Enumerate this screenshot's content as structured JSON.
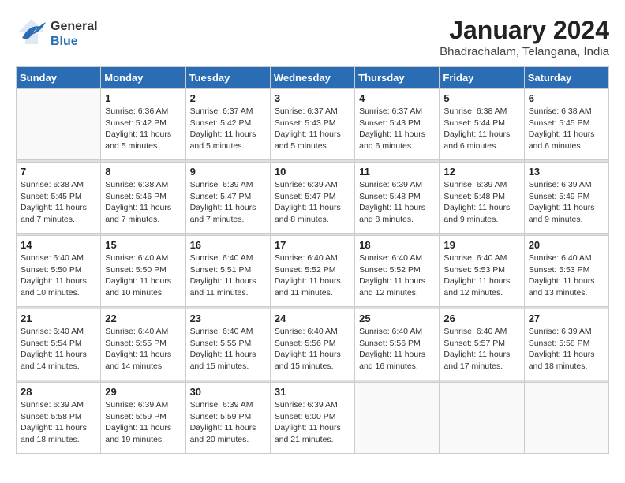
{
  "header": {
    "logo_line1": "General",
    "logo_line2": "Blue",
    "month_title": "January 2024",
    "subtitle": "Bhadrachalam, Telangana, India"
  },
  "weekdays": [
    "Sunday",
    "Monday",
    "Tuesday",
    "Wednesday",
    "Thursday",
    "Friday",
    "Saturday"
  ],
  "weeks": [
    [
      {
        "day": "",
        "info": ""
      },
      {
        "day": "1",
        "info": "Sunrise: 6:36 AM\nSunset: 5:42 PM\nDaylight: 11 hours\nand 5 minutes."
      },
      {
        "day": "2",
        "info": "Sunrise: 6:37 AM\nSunset: 5:42 PM\nDaylight: 11 hours\nand 5 minutes."
      },
      {
        "day": "3",
        "info": "Sunrise: 6:37 AM\nSunset: 5:43 PM\nDaylight: 11 hours\nand 5 minutes."
      },
      {
        "day": "4",
        "info": "Sunrise: 6:37 AM\nSunset: 5:43 PM\nDaylight: 11 hours\nand 6 minutes."
      },
      {
        "day": "5",
        "info": "Sunrise: 6:38 AM\nSunset: 5:44 PM\nDaylight: 11 hours\nand 6 minutes."
      },
      {
        "day": "6",
        "info": "Sunrise: 6:38 AM\nSunset: 5:45 PM\nDaylight: 11 hours\nand 6 minutes."
      }
    ],
    [
      {
        "day": "7",
        "info": "Sunrise: 6:38 AM\nSunset: 5:45 PM\nDaylight: 11 hours\nand 7 minutes."
      },
      {
        "day": "8",
        "info": "Sunrise: 6:38 AM\nSunset: 5:46 PM\nDaylight: 11 hours\nand 7 minutes."
      },
      {
        "day": "9",
        "info": "Sunrise: 6:39 AM\nSunset: 5:47 PM\nDaylight: 11 hours\nand 7 minutes."
      },
      {
        "day": "10",
        "info": "Sunrise: 6:39 AM\nSunset: 5:47 PM\nDaylight: 11 hours\nand 8 minutes."
      },
      {
        "day": "11",
        "info": "Sunrise: 6:39 AM\nSunset: 5:48 PM\nDaylight: 11 hours\nand 8 minutes."
      },
      {
        "day": "12",
        "info": "Sunrise: 6:39 AM\nSunset: 5:48 PM\nDaylight: 11 hours\nand 9 minutes."
      },
      {
        "day": "13",
        "info": "Sunrise: 6:39 AM\nSunset: 5:49 PM\nDaylight: 11 hours\nand 9 minutes."
      }
    ],
    [
      {
        "day": "14",
        "info": "Sunrise: 6:40 AM\nSunset: 5:50 PM\nDaylight: 11 hours\nand 10 minutes."
      },
      {
        "day": "15",
        "info": "Sunrise: 6:40 AM\nSunset: 5:50 PM\nDaylight: 11 hours\nand 10 minutes."
      },
      {
        "day": "16",
        "info": "Sunrise: 6:40 AM\nSunset: 5:51 PM\nDaylight: 11 hours\nand 11 minutes."
      },
      {
        "day": "17",
        "info": "Sunrise: 6:40 AM\nSunset: 5:52 PM\nDaylight: 11 hours\nand 11 minutes."
      },
      {
        "day": "18",
        "info": "Sunrise: 6:40 AM\nSunset: 5:52 PM\nDaylight: 11 hours\nand 12 minutes."
      },
      {
        "day": "19",
        "info": "Sunrise: 6:40 AM\nSunset: 5:53 PM\nDaylight: 11 hours\nand 12 minutes."
      },
      {
        "day": "20",
        "info": "Sunrise: 6:40 AM\nSunset: 5:53 PM\nDaylight: 11 hours\nand 13 minutes."
      }
    ],
    [
      {
        "day": "21",
        "info": "Sunrise: 6:40 AM\nSunset: 5:54 PM\nDaylight: 11 hours\nand 14 minutes."
      },
      {
        "day": "22",
        "info": "Sunrise: 6:40 AM\nSunset: 5:55 PM\nDaylight: 11 hours\nand 14 minutes."
      },
      {
        "day": "23",
        "info": "Sunrise: 6:40 AM\nSunset: 5:55 PM\nDaylight: 11 hours\nand 15 minutes."
      },
      {
        "day": "24",
        "info": "Sunrise: 6:40 AM\nSunset: 5:56 PM\nDaylight: 11 hours\nand 15 minutes."
      },
      {
        "day": "25",
        "info": "Sunrise: 6:40 AM\nSunset: 5:56 PM\nDaylight: 11 hours\nand 16 minutes."
      },
      {
        "day": "26",
        "info": "Sunrise: 6:40 AM\nSunset: 5:57 PM\nDaylight: 11 hours\nand 17 minutes."
      },
      {
        "day": "27",
        "info": "Sunrise: 6:39 AM\nSunset: 5:58 PM\nDaylight: 11 hours\nand 18 minutes."
      }
    ],
    [
      {
        "day": "28",
        "info": "Sunrise: 6:39 AM\nSunset: 5:58 PM\nDaylight: 11 hours\nand 18 minutes."
      },
      {
        "day": "29",
        "info": "Sunrise: 6:39 AM\nSunset: 5:59 PM\nDaylight: 11 hours\nand 19 minutes."
      },
      {
        "day": "30",
        "info": "Sunrise: 6:39 AM\nSunset: 5:59 PM\nDaylight: 11 hours\nand 20 minutes."
      },
      {
        "day": "31",
        "info": "Sunrise: 6:39 AM\nSunset: 6:00 PM\nDaylight: 11 hours\nand 21 minutes."
      },
      {
        "day": "",
        "info": ""
      },
      {
        "day": "",
        "info": ""
      },
      {
        "day": "",
        "info": ""
      }
    ]
  ]
}
